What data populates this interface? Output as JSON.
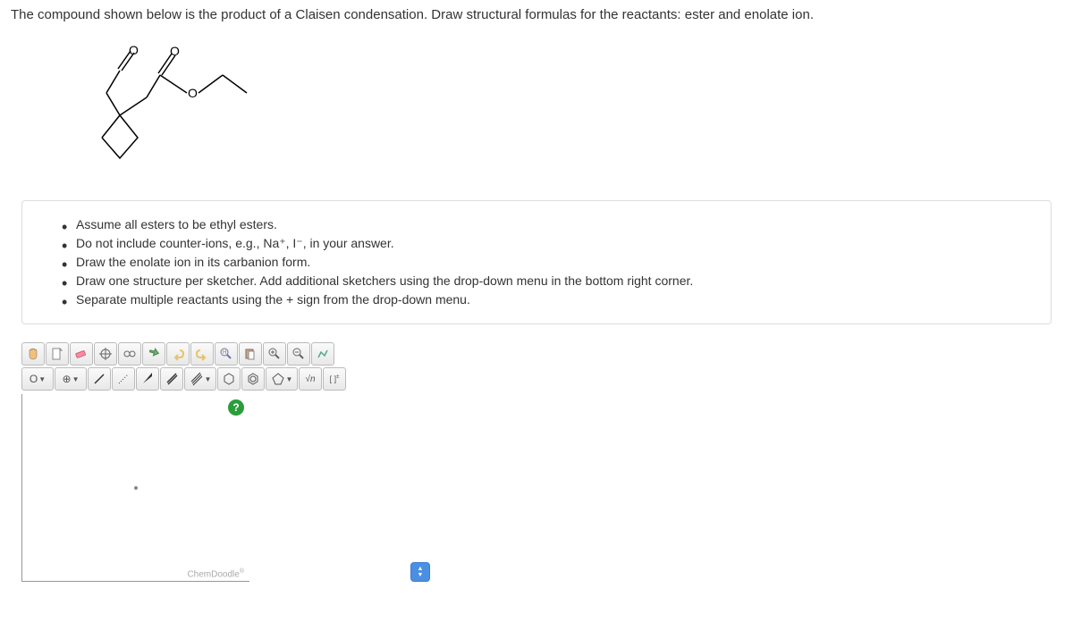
{
  "question": {
    "text": "The compound shown below is the product of a Claisen condensation. Draw structural formulas for the reactants: ester and enolate ion."
  },
  "instructions": {
    "items": [
      "Assume all esters to be ethyl esters.",
      "Do not include counter-ions, e.g., Na⁺, I⁻, in your answer.",
      "Draw the enolate ion in its carbanion form.",
      "Draw one structure per sketcher. Add additional sketchers using the drop-down menu in the bottom right corner.",
      "Separate multiple reactants using the + sign from the drop-down menu."
    ]
  },
  "toolbar": {
    "row1": {
      "hand": "✋",
      "clipboard": "📋",
      "eraser": "eraser",
      "center": "⊕",
      "glasses": "👓",
      "flip": "↕",
      "undo": "↶",
      "redo": "↷",
      "search": "🔍",
      "paste": "📄",
      "zoomin": "🔍+",
      "zoomout": "🔍-",
      "tools": "⚙"
    },
    "row2": {
      "element": "O",
      "charge": "⊕",
      "single": "/",
      "dashed": "⋰",
      "wedge": "◢",
      "double": "//",
      "triple": "///",
      "benzene": "⬡",
      "cyclohex": "⬡",
      "cyclopent": "⬠",
      "chain": "√n",
      "bracket": "[ ]±"
    }
  },
  "canvas": {
    "help": "?",
    "brand": "ChemDoodle"
  }
}
